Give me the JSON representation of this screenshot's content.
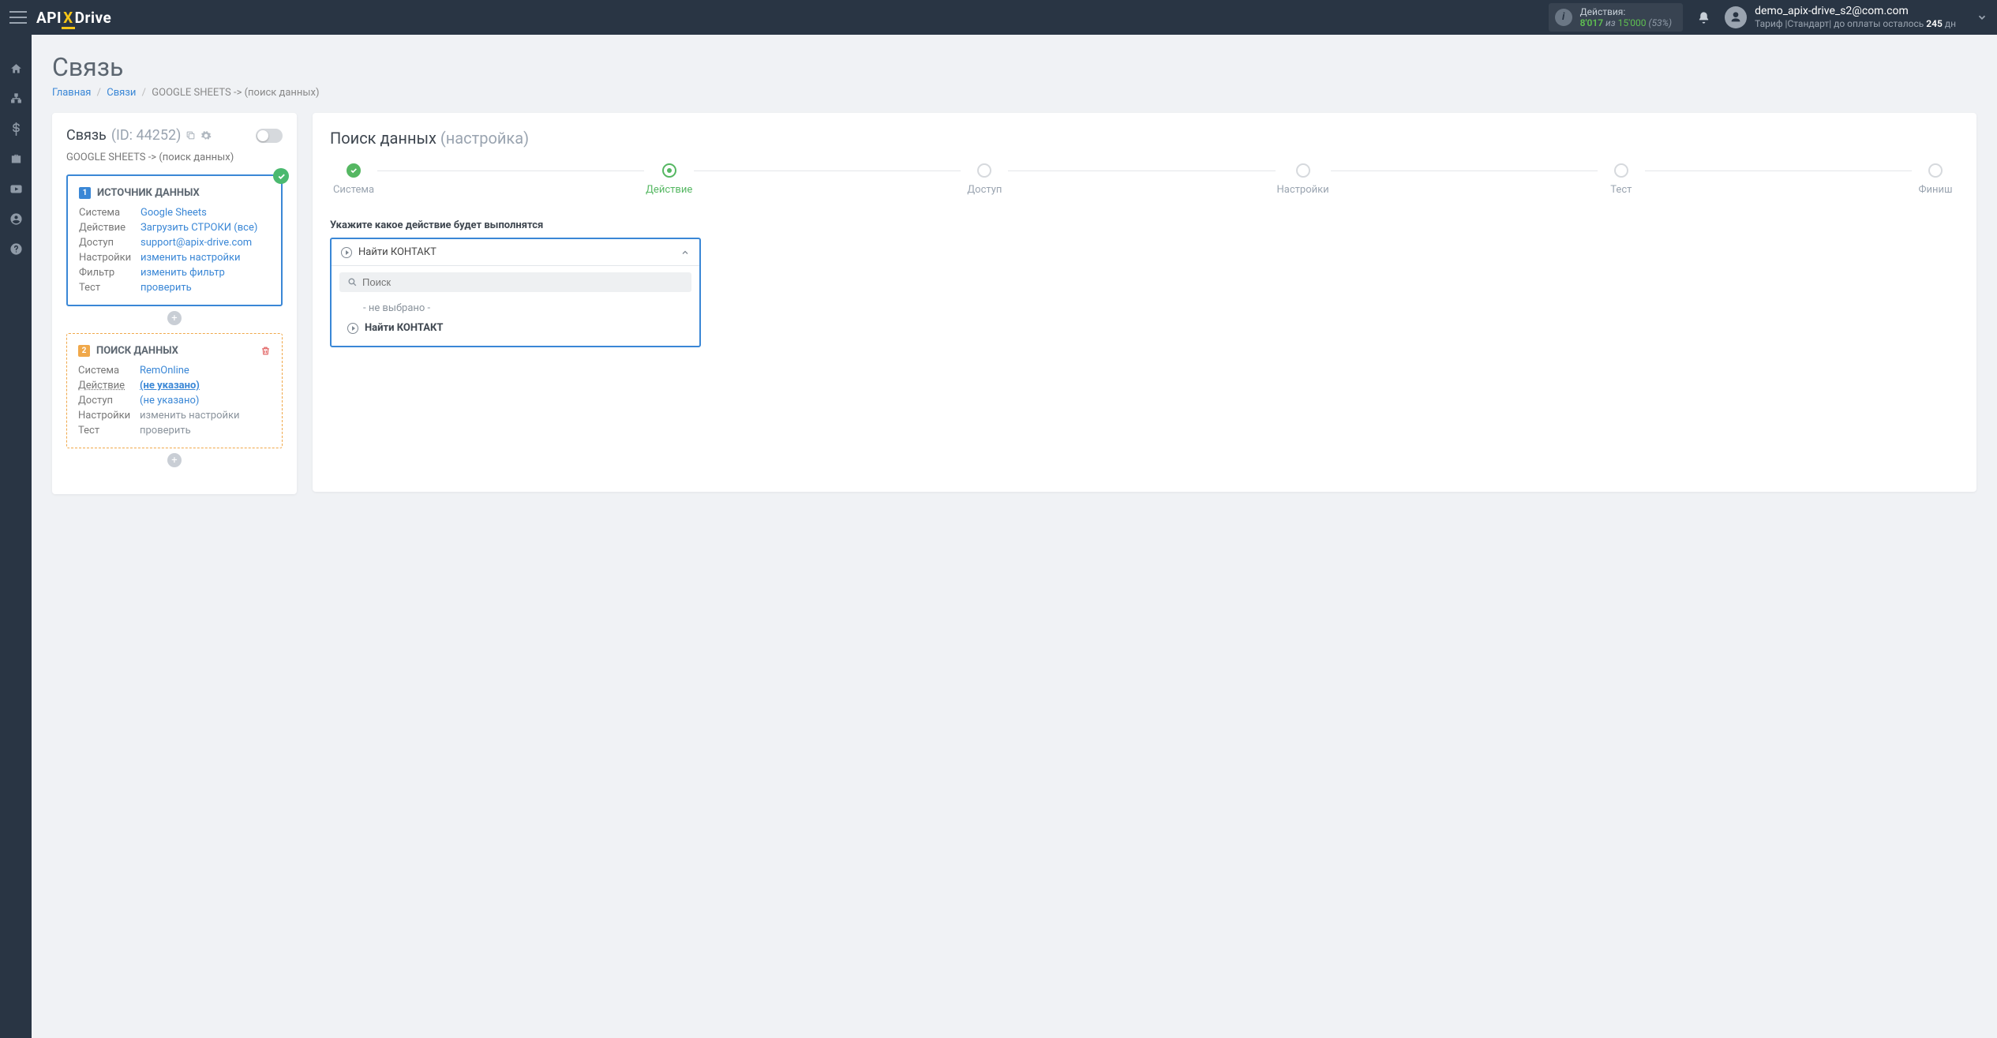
{
  "header": {
    "actions_label": "Действия:",
    "actions_used": "8'017",
    "actions_sep": "из",
    "actions_total": "15'000",
    "actions_pct": "(53%)",
    "user_email": "demo_apix-drive_s2@com.com",
    "plan_prefix": "Тариф |",
    "plan_name": "Стандарт",
    "plan_suffix": "| до оплаты осталось",
    "plan_days": "245",
    "plan_days_unit": "дн"
  },
  "page": {
    "title": "Связь",
    "crumb_home": "Главная",
    "crumb_links": "Связи",
    "crumb_current": "GOOGLE SHEETS -> (поиск данных)"
  },
  "left": {
    "title_name": "Связь",
    "title_id": "(ID: 44252)",
    "sub": "GOOGLE SHEETS -> (поиск данных)",
    "box1": {
      "title": "ИСТОЧНИК ДАННЫХ",
      "rows": {
        "system_k": "Система",
        "system_v": "Google Sheets",
        "action_k": "Действие",
        "action_v": "Загрузить СТРОКИ (все)",
        "access_k": "Доступ",
        "access_v": "support@apix-drive.com",
        "settings_k": "Настройки",
        "settings_v": "изменить настройки",
        "filter_k": "Фильтр",
        "filter_v": "изменить фильтр",
        "test_k": "Тест",
        "test_v": "проверить"
      }
    },
    "box2": {
      "title": "ПОИСК ДАННЫХ",
      "rows": {
        "system_k": "Система",
        "system_v": "RemOnline",
        "action_k": "Действие",
        "action_v": "(не указано)",
        "access_k": "Доступ",
        "access_v": "(не указано)",
        "settings_k": "Настройки",
        "settings_v": "изменить настройки",
        "test_k": "Тест",
        "test_v": "проверить"
      }
    }
  },
  "right": {
    "title": "Поиск данных",
    "title_dim": "(настройка)",
    "steps": [
      "Система",
      "Действие",
      "Доступ",
      "Настройки",
      "Тест",
      "Финиш"
    ],
    "field_label": "Укажите какое действие будет выполнятся",
    "dropdown": {
      "selected": "Найти КОНТАКТ",
      "search_placeholder": "Поиск",
      "opt_empty": "- не выбрано -",
      "opt_find": "Найти КОНТАКТ"
    }
  },
  "brand": {
    "api": "API",
    "x": "X",
    "drive": "Drive"
  }
}
